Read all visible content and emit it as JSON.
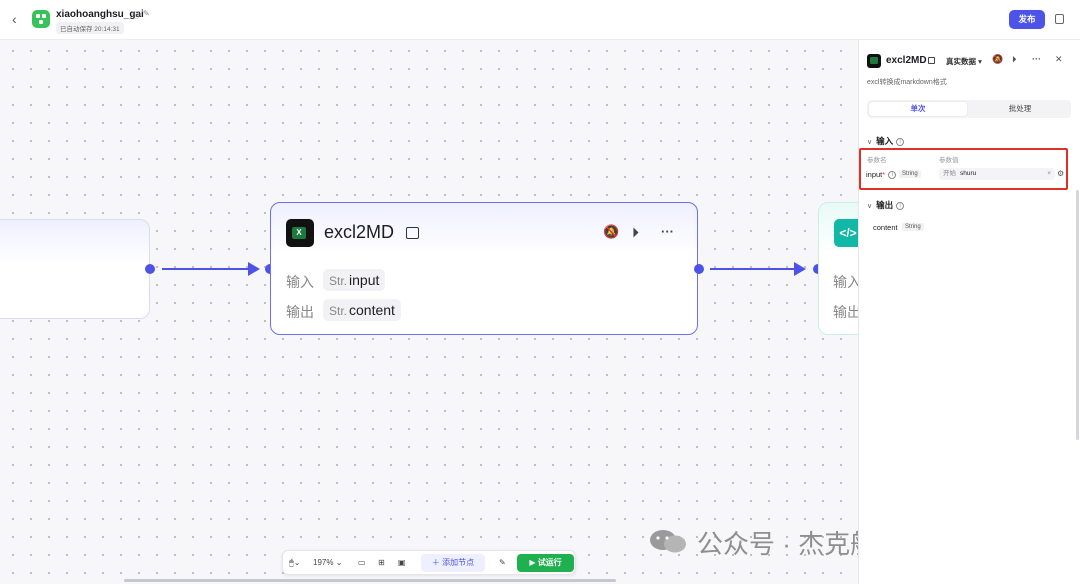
{
  "topbar": {
    "back_icon": "chevron-left-icon",
    "app_name": "xiaohoanghsu_gai",
    "autosave": "已自动保存 20:14:31",
    "publish_label": "发布"
  },
  "canvas": {
    "main_node": {
      "title": "excl2MD",
      "input_row_label": "输入",
      "input_type": "Str.",
      "input_name": "input",
      "output_row_label": "输出",
      "output_type": "Str.",
      "output_name": "content"
    },
    "right_node": {
      "icon_label": "</>",
      "input_row_label": "输入",
      "output_row_label": "输出"
    }
  },
  "toolbar": {
    "zoom": "197%",
    "add_node_label": "添加节点",
    "run_label": "试运行"
  },
  "watermark": {
    "text": "公众号 · 杰克船长的AIGC"
  },
  "panel": {
    "title": "excl2MD",
    "data_mode": "真实数据",
    "description": "excl转换成markdown格式",
    "tabs": [
      {
        "label": "单次",
        "active": true
      },
      {
        "label": "批处理",
        "active": false
      }
    ],
    "input_section": {
      "title": "输入",
      "col_param_name": "参数名",
      "col_param_value": "参数值",
      "param_name": "input",
      "param_type": "String",
      "value_source": "开始",
      "value": "shuru"
    },
    "output_section": {
      "title": "输出",
      "param_name": "content",
      "param_type": "String"
    }
  },
  "colors": {
    "accent": "#4d53e8",
    "run_green": "#1fb04f",
    "highlight_red": "#e0302a"
  }
}
